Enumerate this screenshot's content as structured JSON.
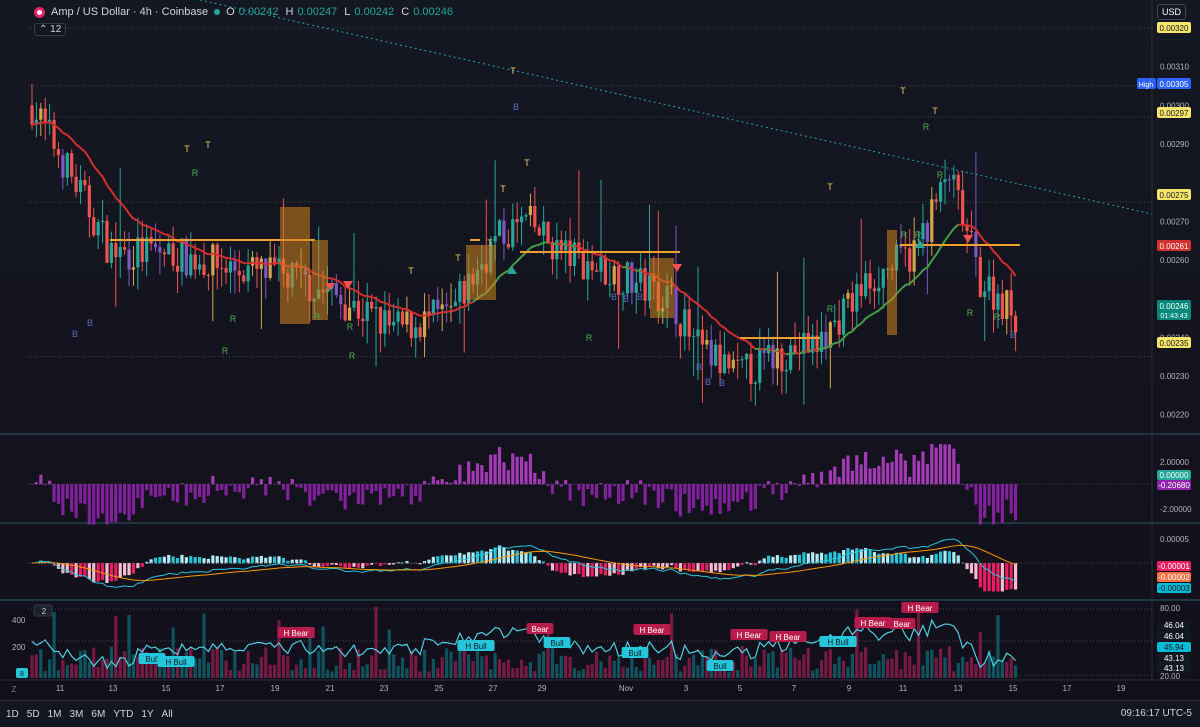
{
  "header": {
    "symbol": "Amp / US Dollar · 4h · Coinbase",
    "ohlc": [
      {
        "k": "O",
        "v": "0.00242"
      },
      {
        "k": "H",
        "v": "0.00247"
      },
      {
        "k": "L",
        "v": "0.00242"
      },
      {
        "k": "C",
        "v": "0.00246"
      }
    ],
    "indicator_count": "12",
    "currency": "USD"
  },
  "main_pane": {
    "price_ticks": [
      "0.00310",
      "0.00300",
      "0.00290",
      "0.00270",
      "0.00260",
      "0.00240",
      "0.00230",
      "0.00220"
    ],
    "price_labels": [
      {
        "text": "0.00320",
        "kind": "yellow"
      },
      {
        "text": "0.00305",
        "kind": "blue",
        "prefix": "High"
      },
      {
        "text": "0.00297",
        "kind": "yellow"
      },
      {
        "text": "0.00275",
        "kind": "yellow"
      },
      {
        "text": "0.00261",
        "kind": "red"
      },
      {
        "text": "0.00246",
        "kind": "teal",
        "sub": "01:43:43"
      },
      {
        "text": "0.00235",
        "kind": "yellow"
      }
    ],
    "signal_letters": [
      "T",
      "R",
      "B"
    ]
  },
  "osc1": {
    "ticks": [
      "2.00000",
      "-2.00000"
    ],
    "labels": [
      {
        "text": "0.00000",
        "kind": "green"
      },
      {
        "text": "-0.20680",
        "kind": "purple"
      }
    ]
  },
  "osc2": {
    "ticks": [
      "0.00005",
      "-0.00005"
    ],
    "labels": [
      {
        "text": "-0.00001",
        "kind": "pink"
      },
      {
        "text": "-0.00002",
        "kind": "orange"
      },
      {
        "text": "-0.00003",
        "kind": "cyan"
      }
    ]
  },
  "osc3": {
    "left_ticks": [
      "400",
      "200"
    ],
    "right_ticks": [
      "80.00",
      "20.00"
    ],
    "labels": [
      {
        "text": "46.04",
        "kind": "dark"
      },
      {
        "text": "46.04",
        "kind": "dark"
      },
      {
        "text": "45.94",
        "kind": "cyan"
      },
      {
        "text": "43.13",
        "kind": "dark"
      },
      {
        "text": "43.13",
        "kind": "dark"
      }
    ],
    "pane_index": "2",
    "left_badge": "8",
    "tags": [
      {
        "text": "H Bear",
        "type": "bear"
      },
      {
        "text": "Bear",
        "type": "bear"
      },
      {
        "text": "H Bear",
        "type": "bear"
      },
      {
        "text": "H Bear",
        "type": "bear"
      },
      {
        "text": "H Bear",
        "type": "bear"
      },
      {
        "text": "H Bear",
        "type": "bear"
      },
      {
        "text": "Bear",
        "type": "bear"
      },
      {
        "text": "H Bear",
        "type": "bear"
      },
      {
        "text": "Bull",
        "type": "bull"
      },
      {
        "text": "H Bull",
        "type": "bull"
      },
      {
        "text": "H Bull",
        "type": "bull"
      },
      {
        "text": "Bull",
        "type": "bull"
      },
      {
        "text": "Bull",
        "type": "bull"
      },
      {
        "text": "Bull",
        "type": "bull"
      },
      {
        "text": "H Bull",
        "type": "bull"
      }
    ]
  },
  "x_axis": {
    "labels": [
      "11",
      "13",
      "15",
      "17",
      "19",
      "21",
      "23",
      "25",
      "27",
      "29",
      "Nov",
      "3",
      "5",
      "7",
      "9",
      "11",
      "13",
      "15",
      "17",
      "19"
    ],
    "corner": "Z"
  },
  "bottom_bar": {
    "timeframes": [
      "1D",
      "5D",
      "1M",
      "3M",
      "6M",
      "YTD",
      "1Y",
      "All"
    ],
    "clock": "09:16:17 UTC-5"
  },
  "colors": {
    "bg": "#131722",
    "up": "#26a69a",
    "down": "#ef5350",
    "orange": "#f0a030",
    "purple": "#9c27b0",
    "cyan": "#26c6da",
    "pink": "#e91e63",
    "signal_yellow": "#f0d060",
    "signal_green": "#4caf50",
    "signal_blue": "#5c6bc0"
  }
}
